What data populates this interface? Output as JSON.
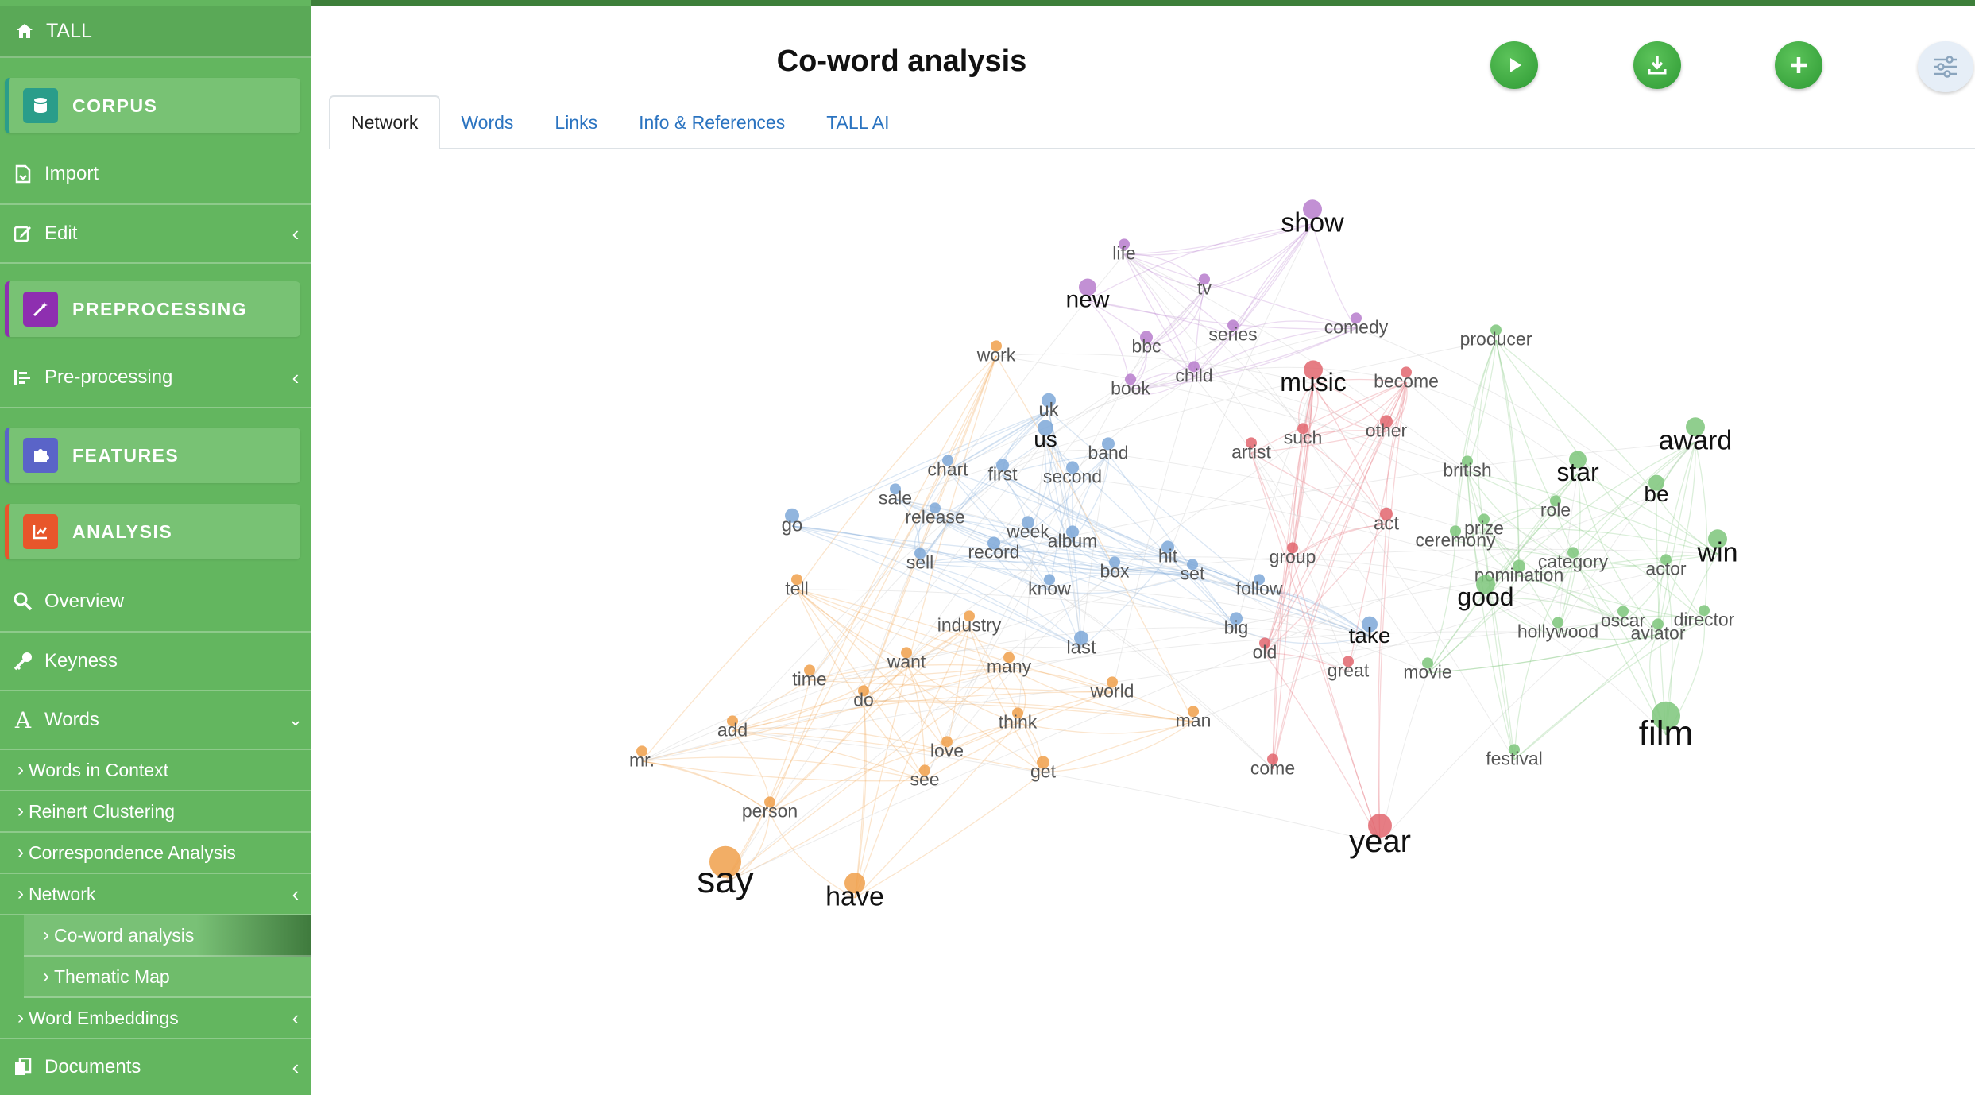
{
  "app": {
    "title": "TALL"
  },
  "sidebar": {
    "corpus": "CORPUS",
    "import": "Import",
    "edit": "Edit",
    "preprocessing": "PREPROCESSING",
    "pre_processing": "Pre-processing",
    "features": "FEATURES",
    "analysis": "ANALYSIS",
    "overview": "Overview",
    "keyness": "Keyness",
    "words": "Words",
    "words_in_context": "Words in Context",
    "reinert": "Reinert Clustering",
    "correspondence": "Correspondence Analysis",
    "network": "Network",
    "coword": "Co-word analysis",
    "thematic": "Thematic Map",
    "embeddings": "Word Embeddings",
    "documents": "Documents"
  },
  "main": {
    "title": "Co-word analysis",
    "tabs": [
      "Network",
      "Words",
      "Links",
      "Info & References",
      "TALL AI"
    ],
    "active_tab": "Network"
  },
  "buttons": {
    "run": "play-icon",
    "download": "download-icon",
    "add": "plus-icon",
    "settings": "sliders-icon"
  },
  "colors": {
    "sidebar": "#63b65f",
    "accent_green": "#2e9a34",
    "tab_link": "#2a73c0",
    "cluster_blue": "#7ea8d8",
    "cluster_red": "#e2666f",
    "cluster_green": "#7cc57a",
    "cluster_orange": "#f0a04b",
    "cluster_purple": "#b77dcc"
  },
  "network": {
    "clusters": {
      "blue": [
        "us",
        "uk",
        "band",
        "chart",
        "first",
        "second",
        "sale",
        "release",
        "week",
        "album",
        "go",
        "sell",
        "record",
        "box",
        "hit",
        "set",
        "follow",
        "know",
        "last",
        "big",
        "take"
      ],
      "red": [
        "music",
        "artist",
        "such",
        "other",
        "act",
        "group",
        "old",
        "great",
        "come",
        "year",
        "become"
      ],
      "green": [
        "producer",
        "award",
        "star",
        "be",
        "british",
        "role",
        "prize",
        "ceremony",
        "category",
        "nomination",
        "actor",
        "win",
        "good",
        "hollywood",
        "oscar",
        "aviator",
        "director",
        "movie",
        "festival",
        "film"
      ],
      "orange": [
        "work",
        "tell",
        "industry",
        "want",
        "many",
        "time",
        "do",
        "world",
        "add",
        "think",
        "man",
        "love",
        "get",
        "see",
        "mr.",
        "person",
        "say",
        "have"
      ],
      "purple": [
        "show",
        "life",
        "tv",
        "new",
        "series",
        "comedy",
        "bbc",
        "book",
        "child"
      ]
    }
  }
}
